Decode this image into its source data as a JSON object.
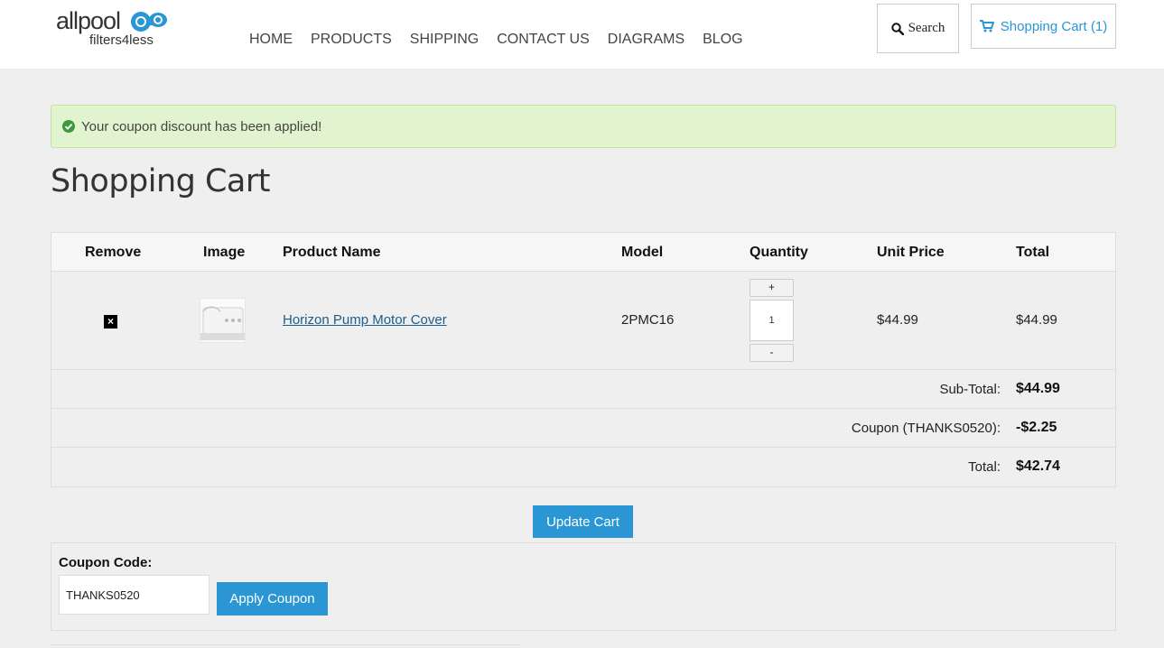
{
  "header": {
    "logo_top": "allpool",
    "logo_bottom": "filters4less",
    "nav": [
      "HOME",
      "PRODUCTS",
      "SHIPPING",
      "CONTACT US",
      "DIAGRAMS",
      "BLOG"
    ],
    "search_label": "Search",
    "cart_label": "Shopping Cart (1)"
  },
  "alert": {
    "message": "Your coupon discount has been applied!"
  },
  "page_title": "Shopping Cart",
  "table": {
    "headers": [
      "Remove",
      "Image",
      "Product Name",
      "Model",
      "Quantity",
      "Unit Price",
      "Total"
    ],
    "rows": [
      {
        "product_name": "Horizon Pump Motor Cover",
        "model": "2PMC16",
        "quantity": "1",
        "unit_price": "$44.99",
        "total": "$44.99"
      }
    ],
    "plus_label": "+",
    "minus_label": "-",
    "remove_symbol": "×"
  },
  "totals": [
    {
      "label": "Sub-Total:",
      "value": "$44.99"
    },
    {
      "label": "Coupon (THANKS0520):",
      "value": "-$2.25"
    },
    {
      "label": "Total:",
      "value": "$42.74"
    }
  ],
  "update_button": "Update Cart",
  "coupon": {
    "label": "Coupon Code:",
    "value": "THANKS0520",
    "apply_button": "Apply Coupon"
  },
  "colors": {
    "accent": "#2a96d4",
    "alert_bg": "#e2f4cf",
    "link": "#1e5d8a"
  }
}
